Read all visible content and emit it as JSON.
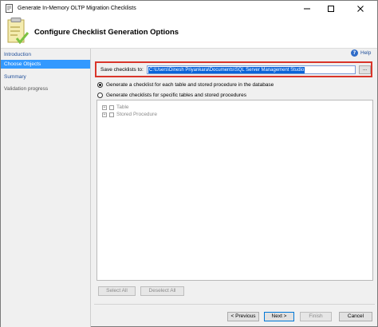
{
  "window": {
    "title": "Generate In-Memory OLTP Migration Checklists"
  },
  "header": {
    "title": "Configure Checklist Generation Options"
  },
  "sidebar": {
    "items": [
      {
        "label": "Introduction"
      },
      {
        "label": "Choose Objects"
      },
      {
        "label": "Summary"
      },
      {
        "label": "Validation progress"
      }
    ]
  },
  "help": {
    "label": "Help"
  },
  "save_path": {
    "label": "Save checklists to:",
    "value": "C:\\Users\\Dinesh Priyankara\\Documents\\SQL Server Management Studio",
    "browse_label": "..."
  },
  "options": {
    "all_objects_label": "Generate a checklist for each table and stored procedure in the database",
    "specific_objects_label": "Generate checklists for specific tables and stored procedures"
  },
  "tree": {
    "nodes": [
      {
        "label": "Table"
      },
      {
        "label": "Stored Procedure"
      }
    ]
  },
  "selection": {
    "select_all_label": "Select All",
    "deselect_all_label": "Deselect All"
  },
  "footer": {
    "previous_label": "< Previous",
    "next_label": "Next >",
    "finish_label": "Finish",
    "cancel_label": "Cancel"
  },
  "colors": {
    "accent": "#3399ff",
    "highlight_border": "#d9352a",
    "link": "#1f4e99"
  },
  "icons": [
    "app-icon",
    "checklist-icon",
    "minimize-icon",
    "maximize-icon",
    "close-icon",
    "help-icon",
    "expand-icon"
  ]
}
